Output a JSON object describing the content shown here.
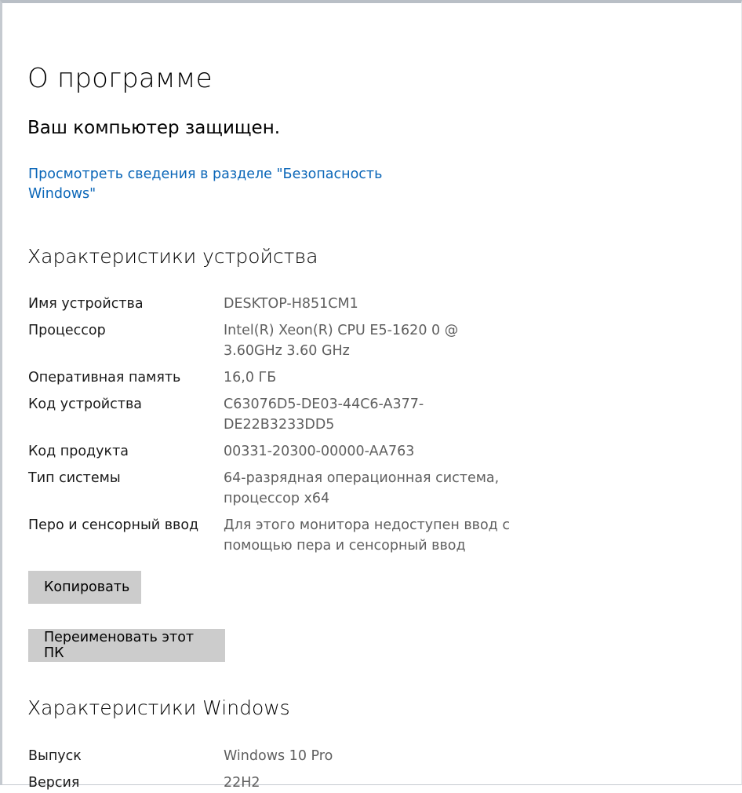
{
  "page": {
    "title": "О программе",
    "protection_status": "Ваш компьютер защищен.",
    "security_link": "Просмотреть сведения в разделе \"Безопасность Windows\""
  },
  "device_specs": {
    "heading": "Характеристики устройства",
    "rows": [
      {
        "label": "Имя устройства",
        "value": "DESKTOP-H851CM1"
      },
      {
        "label": "Процессор",
        "value": "Intel(R) Xeon(R) CPU E5-1620 0 @ 3.60GHz 3.60 GHz"
      },
      {
        "label": "Оперативная память",
        "value": "16,0 ГБ"
      },
      {
        "label": "Код устройства",
        "value": "C63076D5-DE03-44C6-A377-DE22B3233DD5"
      },
      {
        "label": "Код продукта",
        "value": "00331-20300-00000-AA763"
      },
      {
        "label": "Тип системы",
        "value": "64-разрядная операционная система, процессор x64"
      },
      {
        "label": "Перо и сенсорный ввод",
        "value": "Для этого монитора недоступен ввод с помощью пера и сенсорный ввод"
      }
    ],
    "copy_button": "Копировать",
    "rename_button": "Переименовать этот ПК"
  },
  "windows_specs": {
    "heading": "Характеристики Windows",
    "rows": [
      {
        "label": "Выпуск",
        "value": "Windows 10 Pro"
      },
      {
        "label": "Версия",
        "value": "22H2"
      }
    ]
  }
}
